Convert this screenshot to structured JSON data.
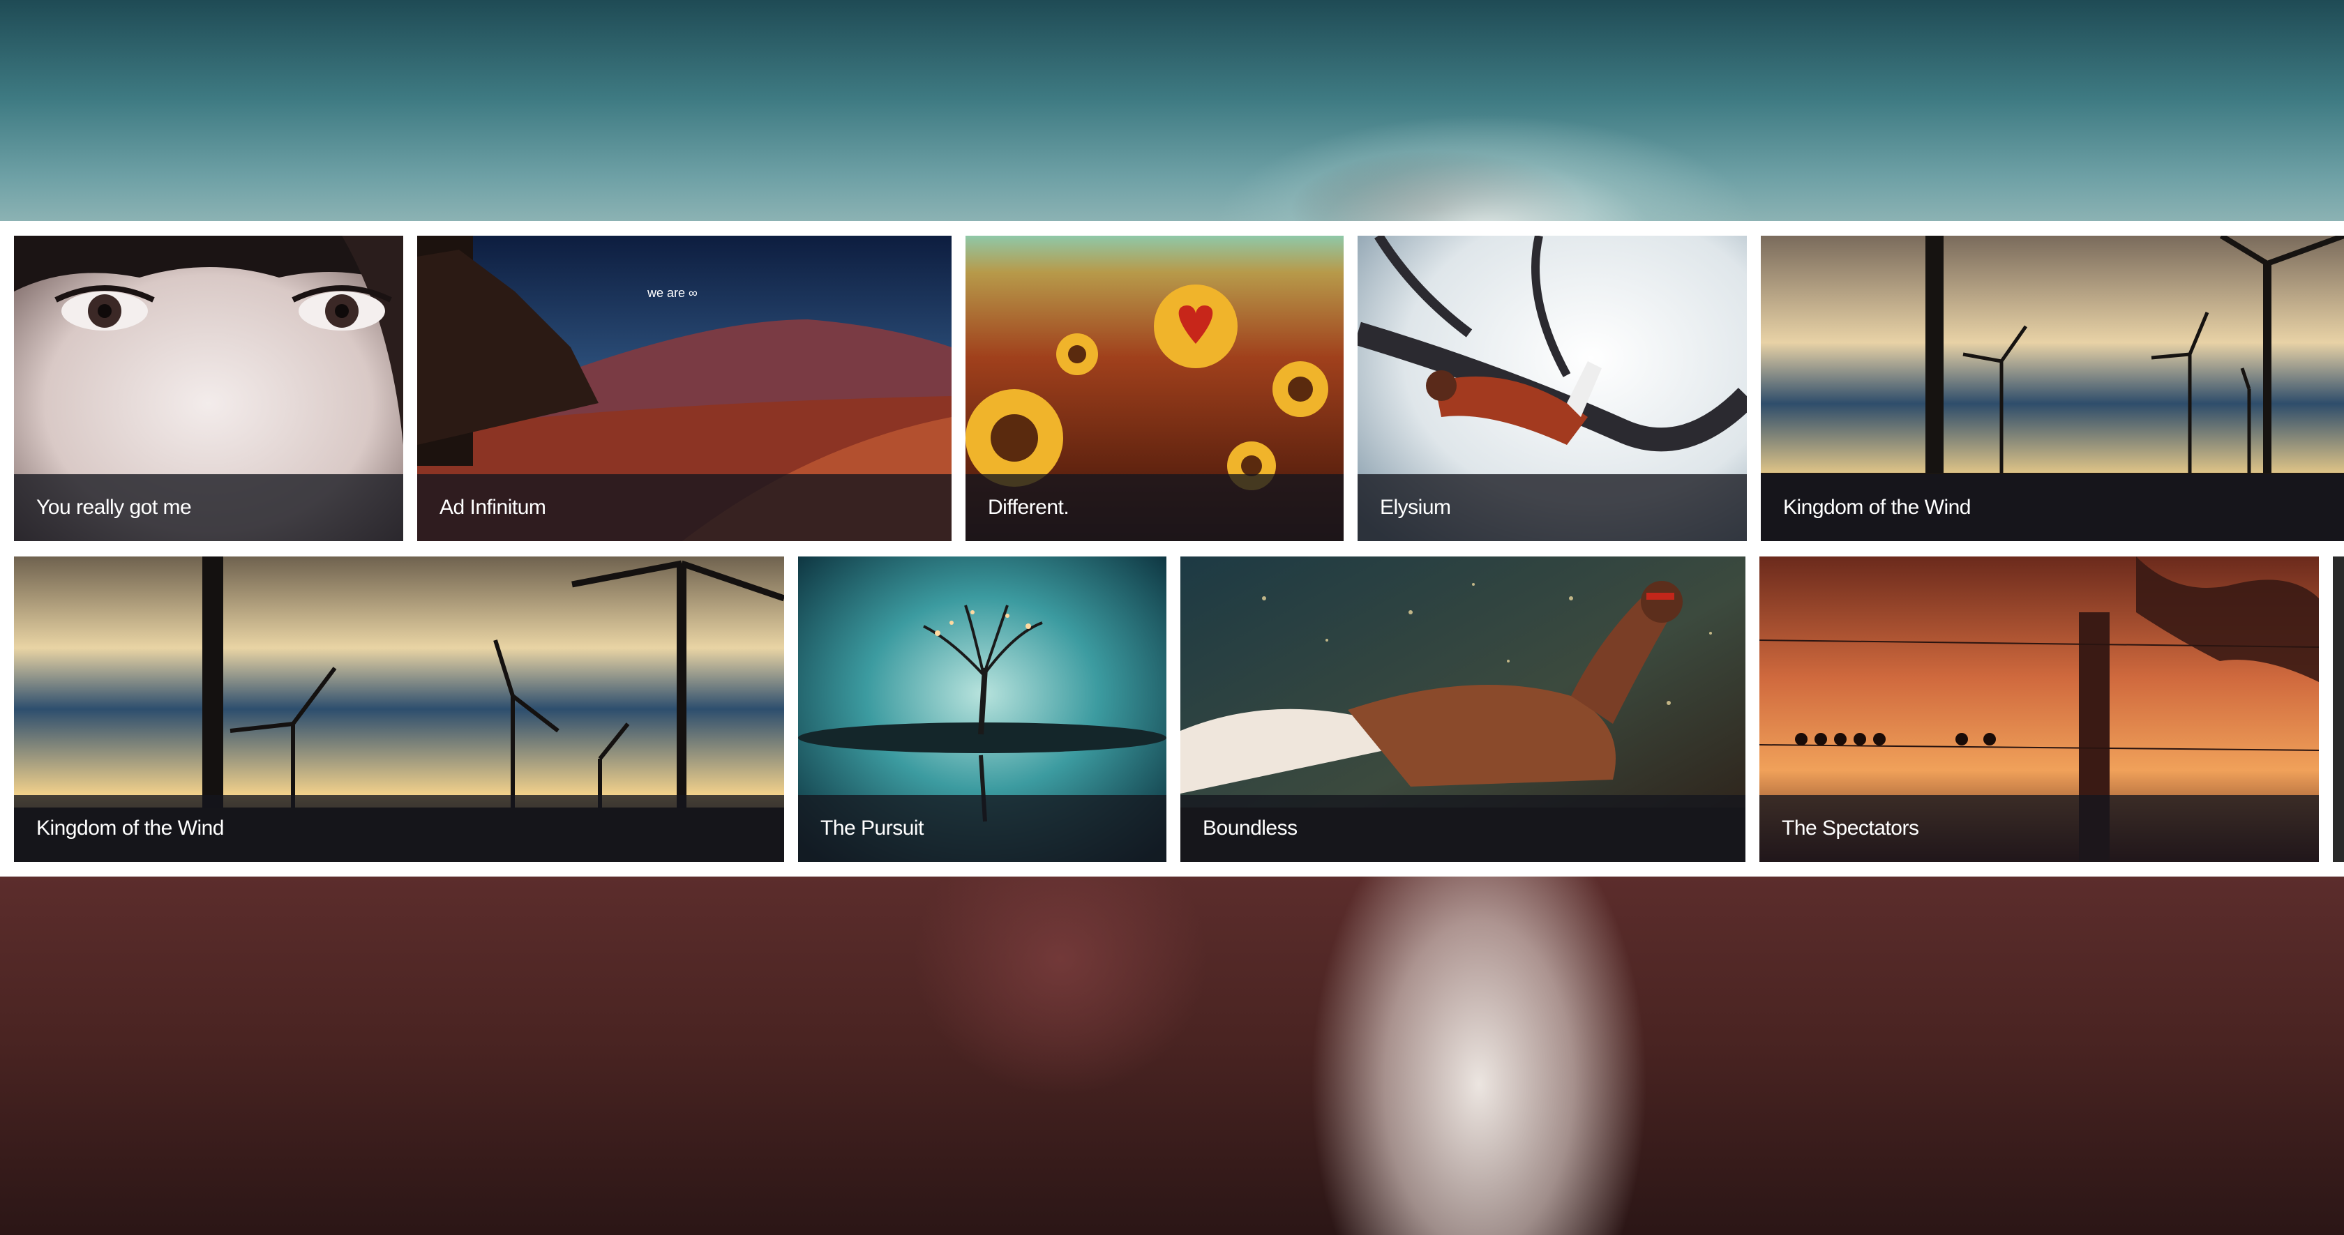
{
  "gallery": {
    "row1": [
      {
        "title": "You really got me"
      },
      {
        "title": "Ad Infinitum"
      },
      {
        "title": "Different."
      },
      {
        "title": "Elysium"
      },
      {
        "title": "Kingdom of the Wind"
      }
    ],
    "row2": [
      {
        "title": "Kingdom of the Wind"
      },
      {
        "title": "The Pursuit"
      },
      {
        "title": "Boundless"
      },
      {
        "title": "The Spectators"
      }
    ]
  },
  "image_text": {
    "ad_infinitum_overlay": "we are ∞"
  }
}
